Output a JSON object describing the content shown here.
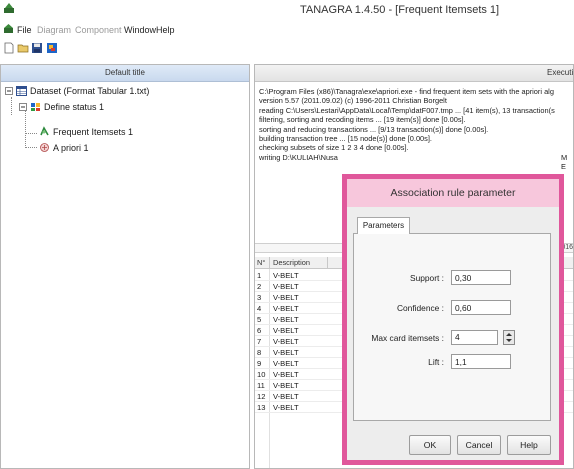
{
  "window": {
    "title": "TANAGRA 1.4.50 - [Frequent Itemsets 1]"
  },
  "menu": {
    "items": [
      {
        "label": "File",
        "enabled": true
      },
      {
        "label": "Diagram",
        "enabled": false
      },
      {
        "label": "Component",
        "enabled": false
      },
      {
        "label": "Window",
        "enabled": true
      },
      {
        "label": "Help",
        "enabled": true
      }
    ]
  },
  "toolbar": {
    "icons": [
      "new-document-icon",
      "open-folder-icon",
      "save-disk-icon",
      "tanagra-app-icon"
    ]
  },
  "left_panel": {
    "header": "Default title",
    "tree": [
      {
        "label": "Dataset (Format Tabular 1.txt)",
        "icon": "dataset-table-icon"
      },
      {
        "label": "Define status 1",
        "icon": "define-status-icon"
      },
      {
        "label": "Frequent Itemsets 1",
        "icon": "itemsets-icon"
      },
      {
        "label": "A priori 1",
        "icon": "apriori-icon"
      }
    ]
  },
  "right_panel": {
    "header": "Executi",
    "log_lines": [
      "C:\\Program Files (x86)\\Tanagra\\exe\\apriori.exe - find frequent item sets with the apriori alg",
      "version 5.57 (2011.09.02)      (c) 1996-2011   Christian Borgelt",
      "reading C:\\Users\\Lestari\\AppData\\Local\\Temp\\datF007.tmp ... [41 item(s), 13 transaction(s",
      "filtering, sorting and recoding items ... [19 item(s)] done [0.00s].",
      "sorting and reducing transactions ... [9/13 transaction(s)] done [0.00s].",
      "building transaction tree ... [15 node(s)] done [0.00s].",
      "checking subsets of size 1 2 3 4 done [0.00s].",
      "writing D:\\KULIAH\\Nusa"
    ],
    "log_tail_right": "M E",
    "results_bar_text": "016",
    "table": {
      "columns": [
        "N°",
        "Description"
      ],
      "rows": [
        {
          "n": "1",
          "desc": "V-BELT"
        },
        {
          "n": "2",
          "desc": "V-BELT"
        },
        {
          "n": "3",
          "desc": "V-BELT"
        },
        {
          "n": "4",
          "desc": "V-BELT"
        },
        {
          "n": "5",
          "desc": "V-BELT"
        },
        {
          "n": "6",
          "desc": "V-BELT"
        },
        {
          "n": "7",
          "desc": "V-BELT"
        },
        {
          "n": "8",
          "desc": "V-BELT"
        },
        {
          "n": "9",
          "desc": "V-BELT"
        },
        {
          "n": "10",
          "desc": "V-BELT"
        },
        {
          "n": "11",
          "desc": "V-BELT"
        },
        {
          "n": "12",
          "desc": "V-BELT"
        },
        {
          "n": "13",
          "desc": "V-BELT"
        }
      ]
    }
  },
  "dialog": {
    "title": "Association rule parameter",
    "tab": "Parameters",
    "fields": {
      "support": {
        "label": "Support :",
        "value": "0,30"
      },
      "confidence": {
        "label": "Confidence :",
        "value": "0,60"
      },
      "max_card": {
        "label": "Max card itemsets :",
        "value": "4"
      },
      "lift": {
        "label": "Lift :",
        "value": "1,1"
      }
    },
    "buttons": {
      "ok": "OK",
      "cancel": "Cancel",
      "help": "Help"
    }
  },
  "colors": {
    "highlight_border": "#e0579b",
    "dialog_title_bg": "#f7c7dc",
    "left_header_bg": "#c9d9ee"
  }
}
